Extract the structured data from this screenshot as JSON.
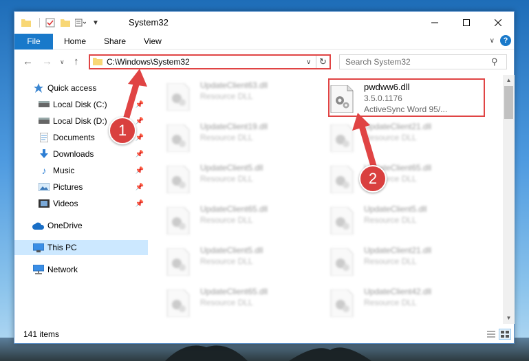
{
  "window": {
    "title": "System32"
  },
  "ribbon": {
    "tabs": [
      "File",
      "Home",
      "Share",
      "View"
    ]
  },
  "navbar": {
    "address": "C:\\Windows\\System32",
    "search_placeholder": "Search System32"
  },
  "navpane": {
    "items": [
      {
        "label": "Quick access",
        "icon": "star-icon"
      },
      {
        "label": "Local Disk (C:)",
        "icon": "drive-icon",
        "pinned": true
      },
      {
        "label": "Local Disk (D:)",
        "icon": "drive-icon",
        "pinned": true
      },
      {
        "label": "Documents",
        "icon": "documents-icon",
        "pinned": true
      },
      {
        "label": "Downloads",
        "icon": "downloads-icon",
        "pinned": true
      },
      {
        "label": "Music",
        "icon": "music-icon",
        "pinned": true
      },
      {
        "label": "Pictures",
        "icon": "pictures-icon",
        "pinned": true
      },
      {
        "label": "Videos",
        "icon": "videos-icon",
        "pinned": true
      },
      {
        "label": "OneDrive",
        "icon": "onedrive-icon"
      },
      {
        "label": "This PC",
        "icon": "this-pc-icon",
        "selected": true
      },
      {
        "label": "Network",
        "icon": "network-icon"
      }
    ]
  },
  "files": [
    {
      "name": "UpdateClient63.dll",
      "desc": "Resource DLL"
    },
    {
      "name": "pwdww6.dll",
      "version": "3.5.0.1176",
      "desc": "ActiveSync Word 95/...",
      "highlighted": true
    },
    {
      "name": "UpdateClient19.dll",
      "desc": "Resource DLL"
    },
    {
      "name": "UpdateClient21.dll",
      "desc": "Resource DLL"
    },
    {
      "name": "UpdateClient5.dll",
      "desc": "Resource DLL"
    },
    {
      "name": "UpdateClient65.dll",
      "desc": "Resource DLL"
    },
    {
      "name": "UpdateClient65.dll",
      "desc": "Resource DLL"
    },
    {
      "name": "UpdateClient5.dll",
      "desc": "Resource DLL"
    },
    {
      "name": "UpdateClient5.dll",
      "desc": "Resource DLL"
    },
    {
      "name": "UpdateClient21.dll",
      "desc": "Resource DLL"
    },
    {
      "name": "UpdateClient65.dll",
      "desc": "Resource DLL"
    },
    {
      "name": "UpdateClient42.dll",
      "desc": "Resource DLL"
    }
  ],
  "status": {
    "item_count": "141 items"
  },
  "callouts": {
    "one": "1",
    "two": "2"
  },
  "colors": {
    "accent": "#1979ca",
    "callout": "#d9403f",
    "selection": "#cce8ff"
  }
}
